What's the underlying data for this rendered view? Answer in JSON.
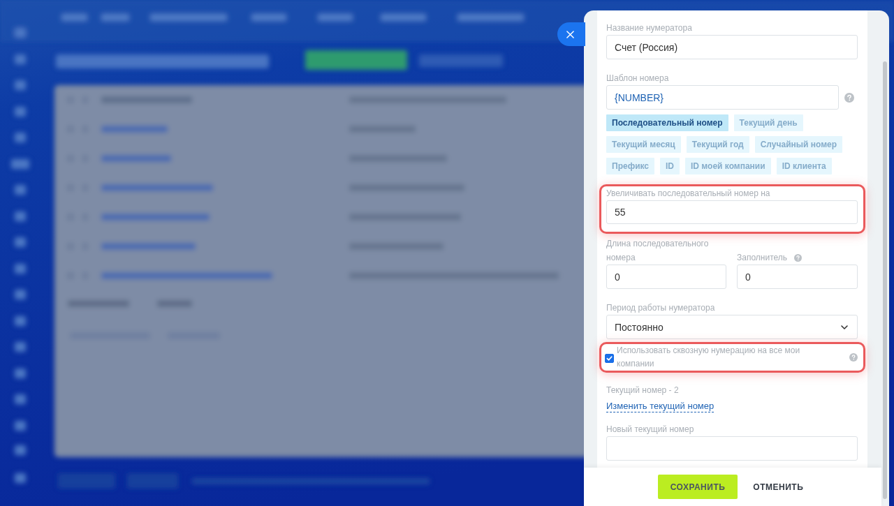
{
  "form": {
    "name_field": {
      "label": "Название нумератора",
      "value": "Счет (Россия)"
    },
    "template_field": {
      "label": "Шаблон номера",
      "value": "{NUMBER}",
      "help": true
    },
    "template_chips": [
      {
        "label": "Последовательный номер",
        "selected": true
      },
      {
        "label": "Текущий день",
        "selected": false
      },
      {
        "label": "Текущий месяц",
        "selected": false
      },
      {
        "label": "Текущий год",
        "selected": false
      },
      {
        "label": "Случайный номер",
        "selected": false
      },
      {
        "label": "Префикс",
        "selected": false
      },
      {
        "label": "ID",
        "selected": false
      },
      {
        "label": "ID моей компании",
        "selected": false
      },
      {
        "label": "ID клиента",
        "selected": false
      }
    ],
    "increment_field": {
      "label": "Увеличивать последовательный номер на",
      "value": "55",
      "highlighted": true
    },
    "length_field": {
      "label": "Длина последовательного номера",
      "value": "0"
    },
    "filler_field": {
      "label": "Заполнитель",
      "value": "0",
      "help": true
    },
    "period_select": {
      "label": "Период работы нумератора",
      "value": "Постоянно"
    },
    "shared_numbering": {
      "label": "Использовать сквозную нумерацию на все мои компании",
      "checked": true,
      "highlighted": true,
      "help": true
    },
    "current_number": "Текущий номер - 2",
    "change_link": "Изменить текущий номер",
    "new_number_field": {
      "label": "Новый текущий номер"
    }
  },
  "footer": {
    "buttons": [
      {
        "label": "СОХРАНИТЬ",
        "kind": "primary"
      },
      {
        "label": "ОТМЕНИТЬ",
        "kind": "secondary"
      }
    ]
  }
}
